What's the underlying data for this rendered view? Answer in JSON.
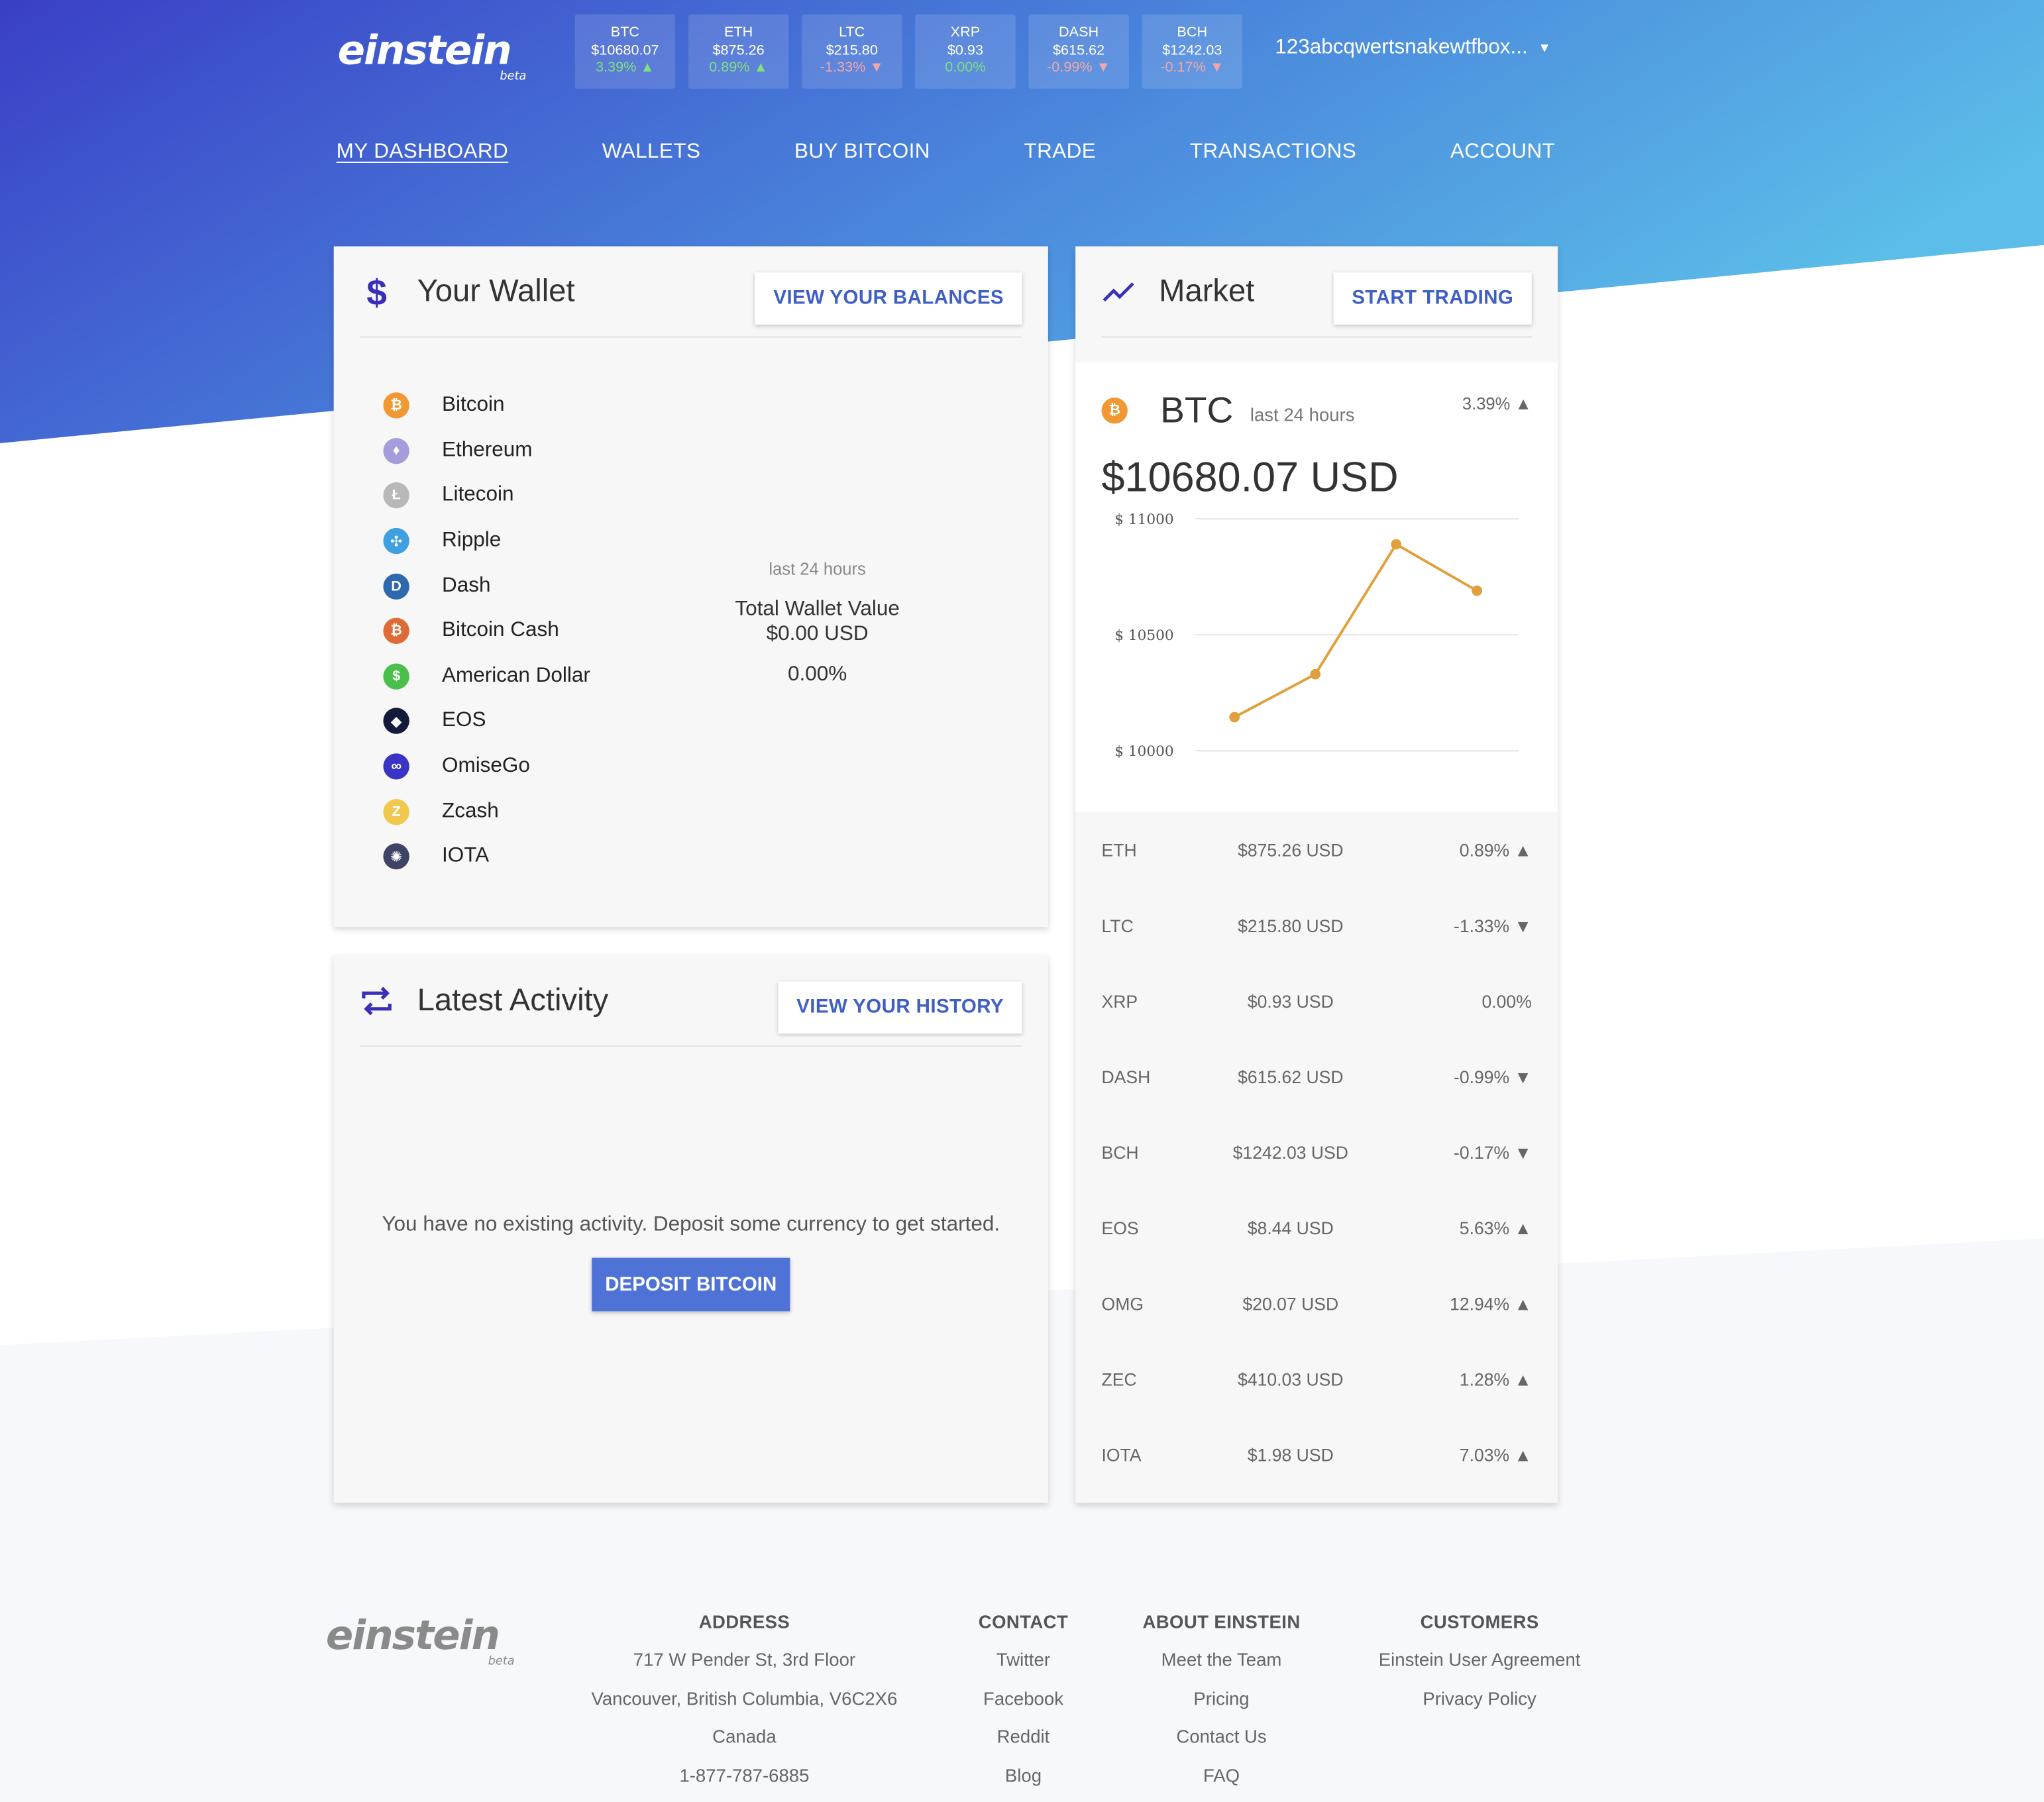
{
  "brand": {
    "name": "einstein",
    "tag": "beta"
  },
  "ticker": [
    {
      "symbol": "BTC",
      "price": "$10680.07",
      "change": "3.39% ▲",
      "dir": "up"
    },
    {
      "symbol": "ETH",
      "price": "$875.26",
      "change": "0.89% ▲",
      "dir": "up"
    },
    {
      "symbol": "LTC",
      "price": "$215.80",
      "change": "-1.33% ▼",
      "dir": "down"
    },
    {
      "symbol": "XRP",
      "price": "$0.93",
      "change": "0.00%",
      "dir": "flat"
    },
    {
      "symbol": "DASH",
      "price": "$615.62",
      "change": "-0.99% ▼",
      "dir": "down"
    },
    {
      "symbol": "BCH",
      "price": "$1242.03",
      "change": "-0.17% ▼",
      "dir": "down"
    }
  ],
  "account": {
    "label": "123abcqwertsnakewtfbox..."
  },
  "nav": [
    "MY DASHBOARD",
    "WALLETS",
    "BUY BITCOIN",
    "TRADE",
    "TRANSACTIONS",
    "ACCOUNT"
  ],
  "wallet": {
    "title": "Your Wallet",
    "button": "VIEW YOUR BALANCES",
    "coins": [
      {
        "name": "Bitcoin",
        "icon": "bitcoin-icon",
        "color": "#f29833",
        "glyph": "₿"
      },
      {
        "name": "Ethereum",
        "icon": "ethereum-icon",
        "color": "#a59cdc",
        "glyph": "♦"
      },
      {
        "name": "Litecoin",
        "icon": "litecoin-icon",
        "color": "#b8b8b8",
        "glyph": "Ł"
      },
      {
        "name": "Ripple",
        "icon": "ripple-icon",
        "color": "#3ea0e0",
        "glyph": "✣"
      },
      {
        "name": "Dash",
        "icon": "dash-icon",
        "color": "#2e69b0",
        "glyph": "D"
      },
      {
        "name": "Bitcoin Cash",
        "icon": "bitcoin-cash-icon",
        "color": "#e06a35",
        "glyph": "₿"
      },
      {
        "name": "American Dollar",
        "icon": "dollar-icon",
        "color": "#4bbf4b",
        "glyph": "$"
      },
      {
        "name": "EOS",
        "icon": "eos-icon",
        "color": "#141a3a",
        "glyph": "◆"
      },
      {
        "name": "OmiseGo",
        "icon": "omisego-icon",
        "color": "#3a34c4",
        "glyph": "∞"
      },
      {
        "name": "Zcash",
        "icon": "zcash-icon",
        "color": "#f1c84e",
        "glyph": "Z"
      },
      {
        "name": "IOTA",
        "icon": "iota-icon",
        "color": "#3f4466",
        "glyph": "✺"
      }
    ],
    "period": "last 24 hours",
    "total_label": "Total Wallet Value",
    "total_value": "$0.00 USD",
    "change": "0.00%"
  },
  "activity": {
    "title": "Latest Activity",
    "button": "VIEW YOUR HISTORY",
    "empty": "You have no existing activity. Deposit some currency to get started.",
    "cta": "DEPOSIT BITCOIN"
  },
  "market": {
    "title": "Market",
    "button": "START TRADING",
    "featured": {
      "symbol": "BTC",
      "period": "last 24 hours",
      "change": "3.39% ▲",
      "price": "$10680.07 USD"
    },
    "rows": [
      {
        "symbol": "ETH",
        "price": "$875.26 USD",
        "change": "0.89% ▲"
      },
      {
        "symbol": "LTC",
        "price": "$215.80 USD",
        "change": "-1.33% ▼"
      },
      {
        "symbol": "XRP",
        "price": "$0.93 USD",
        "change": "0.00%"
      },
      {
        "symbol": "DASH",
        "price": "$615.62 USD",
        "change": "-0.99% ▼"
      },
      {
        "symbol": "BCH",
        "price": "$1242.03 USD",
        "change": "-0.17% ▼"
      },
      {
        "symbol": "EOS",
        "price": "$8.44 USD",
        "change": "5.63% ▲"
      },
      {
        "symbol": "OMG",
        "price": "$20.07 USD",
        "change": "12.94% ▲"
      },
      {
        "symbol": "ZEC",
        "price": "$410.03 USD",
        "change": "1.28% ▲"
      },
      {
        "symbol": "IOTA",
        "price": "$1.98 USD",
        "change": "7.03% ▲"
      }
    ]
  },
  "chart_data": {
    "type": "line",
    "x": [
      1,
      2,
      3,
      4
    ],
    "values": [
      10145,
      10330,
      10890,
      10690
    ],
    "yticks": [
      "$ 11000",
      "$ 10500",
      "$ 10000"
    ],
    "ylim": [
      10000,
      11000
    ],
    "title": "",
    "xlabel": "",
    "ylabel": "",
    "color": "#e0a03c"
  },
  "footer": {
    "columns": [
      {
        "heading": "ADDRESS",
        "items": [
          "717 W Pender St, 3rd Floor",
          "Vancouver, British Columbia, V6C2X6",
          "Canada",
          "1-877-787-6885"
        ]
      },
      {
        "heading": "CONTACT",
        "items": [
          "Twitter",
          "Facebook",
          "Reddit",
          "Blog"
        ]
      },
      {
        "heading": "ABOUT EINSTEIN",
        "items": [
          "Meet the Team",
          "Pricing",
          "Contact Us",
          "FAQ"
        ]
      },
      {
        "heading": "CUSTOMERS",
        "items": [
          "Einstein User Agreement",
          "Privacy Policy"
        ]
      }
    ]
  },
  "colors": {
    "accent": "#3f5fc4",
    "primary_button": "#4e72d6",
    "hero_from": "#3a3fc6",
    "hero_to": "#5bbde8"
  }
}
